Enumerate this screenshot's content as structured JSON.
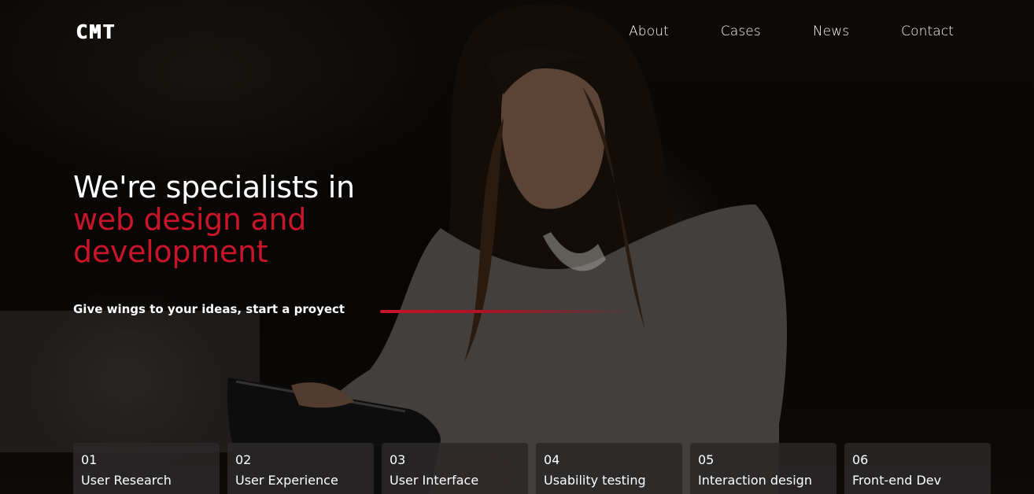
{
  "header": {
    "logo": "CMT",
    "nav": [
      "About",
      "Cases",
      "News",
      "Contact"
    ]
  },
  "hero": {
    "headline_line1": "We're specialists in",
    "headline_line2": "web design and",
    "headline_line3": "development",
    "tagline": "Give wings to your ideas, start a proyect"
  },
  "services": [
    {
      "number": "01",
      "label": "User Research"
    },
    {
      "number": "02",
      "label": "User Experience"
    },
    {
      "number": "03",
      "label": "User Interface"
    },
    {
      "number": "04",
      "label": "Usability testing"
    },
    {
      "number": "05",
      "label": "Interaction design"
    },
    {
      "number": "06",
      "label": "Front-end Dev"
    }
  ],
  "colors": {
    "accent": "#c8152a",
    "text": "#ffffff",
    "card_bg": "#2a2828"
  }
}
